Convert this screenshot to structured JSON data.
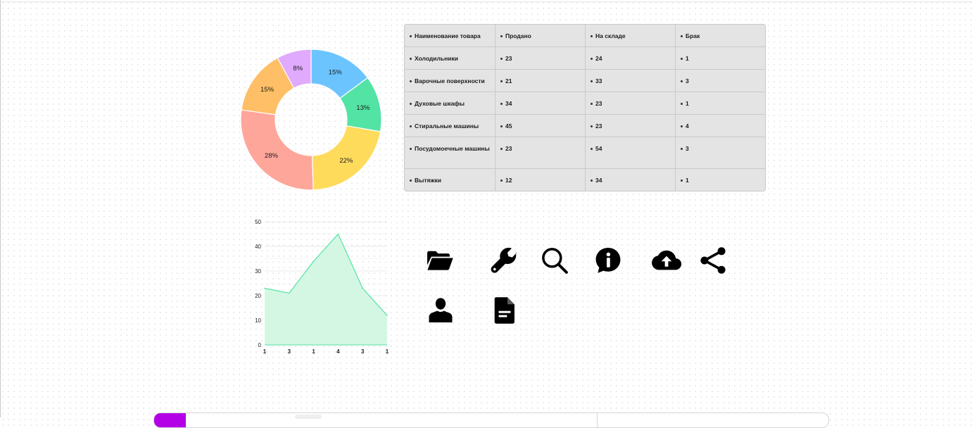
{
  "donut_chart": {
    "slices": [
      {
        "label": "15%",
        "value": 15,
        "color": "#6cc4ff"
      },
      {
        "label": "13%",
        "value": 13,
        "color": "#53e3a5"
      },
      {
        "label": "22%",
        "value": 22,
        "color": "#ffdb5c"
      },
      {
        "label": "28%",
        "value": 28,
        "color": "#ffa69b"
      },
      {
        "label": "15%",
        "value": 15,
        "color": "#ffbf66"
      },
      {
        "label": "8%",
        "value": 8,
        "color": "#e0aaff"
      }
    ]
  },
  "table": {
    "headers": [
      "Наименование товара",
      "Продано",
      "На складе",
      "Брак"
    ],
    "rows": [
      [
        "Холодильники",
        "23",
        "24",
        "1"
      ],
      [
        "Варочные поверхности",
        "21",
        "33",
        "3"
      ],
      [
        "Духовые шкафы",
        "34",
        "23",
        "1"
      ],
      [
        "Стиральные машины",
        "45",
        "23",
        "4"
      ],
      [
        "Посудомоечные машины",
        "23",
        "54",
        "3"
      ],
      [
        "Вытяжки",
        "12",
        "34",
        "1"
      ]
    ]
  },
  "chart_data": {
    "type": "area",
    "categories": [
      "1",
      "3",
      "1",
      "4",
      "3",
      "1"
    ],
    "values": [
      23,
      21,
      34,
      45,
      23,
      12
    ],
    "ylim": [
      0,
      50
    ],
    "yticks": [
      "0",
      "10",
      "20",
      "30",
      "40",
      "50"
    ],
    "grid": true,
    "fill_color": "#d4f7e4",
    "line_color": "#53e3a5"
  },
  "icons": [
    {
      "name": "folder-open-icon"
    },
    {
      "name": "wrench-icon"
    },
    {
      "name": "search-icon"
    },
    {
      "name": "info-icon"
    },
    {
      "name": "cloud-upload-icon"
    },
    {
      "name": "share-icon"
    },
    {
      "name": "user-icon"
    },
    {
      "name": "document-icon"
    }
  ],
  "colors": {
    "accent": "#b400e6",
    "icon": "#000000",
    "table_bg": "#e4e4e4"
  }
}
